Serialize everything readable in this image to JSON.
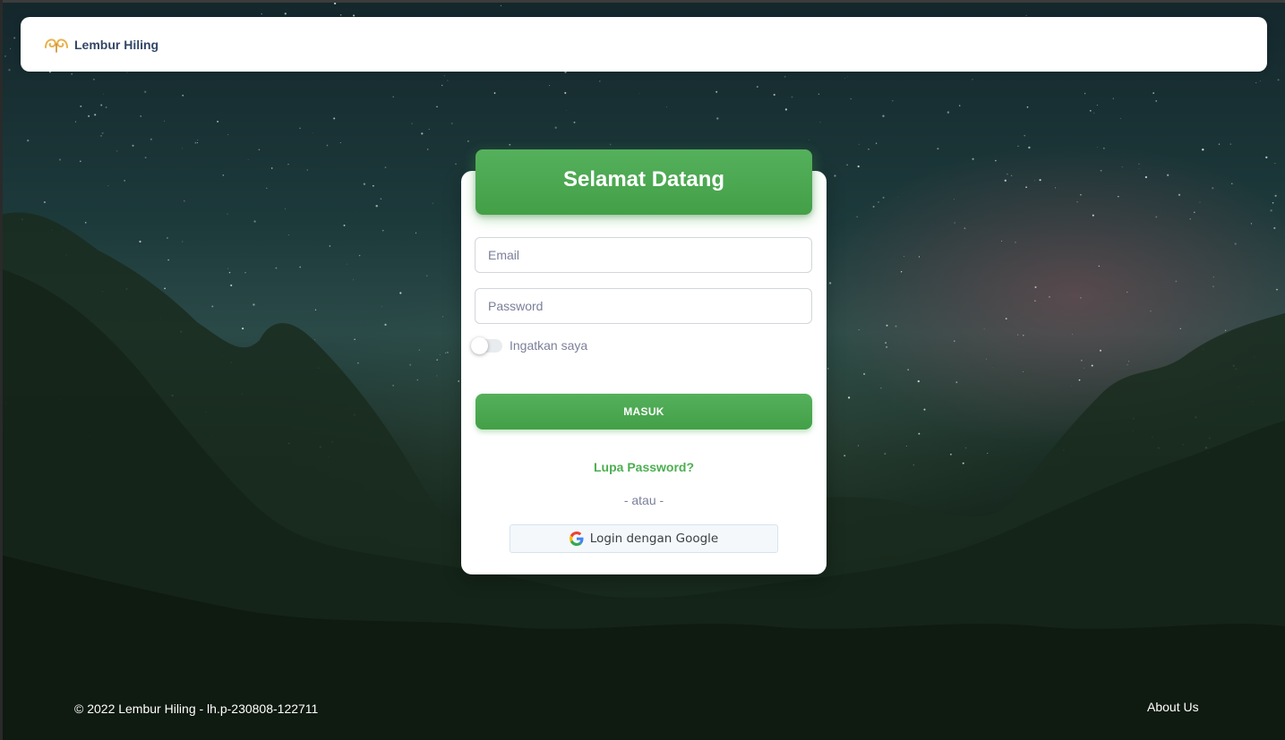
{
  "navbar": {
    "brand_name": "Lembur Hiling",
    "brand_logo_icon": "lembur-hiling-logo-icon"
  },
  "login_card": {
    "title": "Selamat Datang",
    "email": {
      "placeholder": "Email",
      "value": ""
    },
    "password": {
      "placeholder": "Password",
      "value": ""
    },
    "remember_me": {
      "label": "Ingatkan saya",
      "checked": false
    },
    "submit_label": "MASUK",
    "forgot_password_label": "Lupa Password?",
    "divider_label": "- atau -",
    "google_button": {
      "label": "Login dengan Google",
      "icon": "google-icon"
    }
  },
  "footer": {
    "copyright": "© 2022 Lembur Hiling - lh.p-230808-122711",
    "about_label": "About Us"
  },
  "colors": {
    "accent_green": "#4caf50",
    "brand_text": "#344767",
    "muted_text": "#7b809a",
    "logo_gold": "#e8b04a"
  }
}
